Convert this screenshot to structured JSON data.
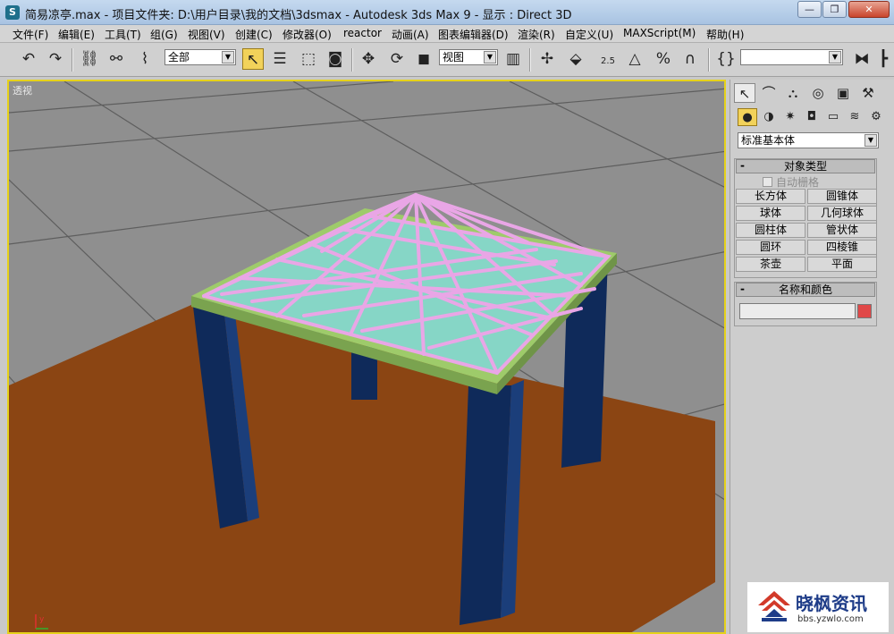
{
  "window": {
    "title": "简易凉亭.max  - 项目文件夹: D:\\用户目录\\我的文档\\3dsmax   - Autodesk 3ds Max 9    - 显示 : Direct 3D",
    "min_glyph": "—",
    "max_glyph": "❐",
    "close_glyph": "✕"
  },
  "menu": [
    "文件(F)",
    "编辑(E)",
    "工具(T)",
    "组(G)",
    "视图(V)",
    "创建(C)",
    "修改器(O)",
    "reactor",
    "动画(A)",
    "图表编辑器(D)",
    "渲染(R)",
    "自定义(U)",
    "MAXScript(M)",
    "帮助(H)"
  ],
  "toolbar": {
    "selection_filter": "全部",
    "reference_coord": "视图",
    "angle_snap_label": "2.5",
    "named_selection": ""
  },
  "viewport": {
    "label": "透视",
    "axis_y_label": "y"
  },
  "command_panel": {
    "category": "标准基本体",
    "object_type_title": "对象类型",
    "autogrid_label": "自动栅格",
    "object_buttons": [
      "长方体",
      "圆锥体",
      "球体",
      "几何球体",
      "圆柱体",
      "管状体",
      "圆环",
      "四棱锥",
      "茶壶",
      "平面"
    ],
    "name_color_title": "名称和颜色",
    "name_value": "",
    "object_color": "#e04848"
  },
  "watermark": {
    "text": "晓枫资讯",
    "url": "bbs.yzwlo.com"
  },
  "colors": {
    "ground": "#8b4513",
    "pillar": "#0f2a5a",
    "glass": "#86d6c6",
    "frame": "#e9a6e6",
    "rim": "#9ecb6a",
    "selection": "#e6d21a"
  }
}
